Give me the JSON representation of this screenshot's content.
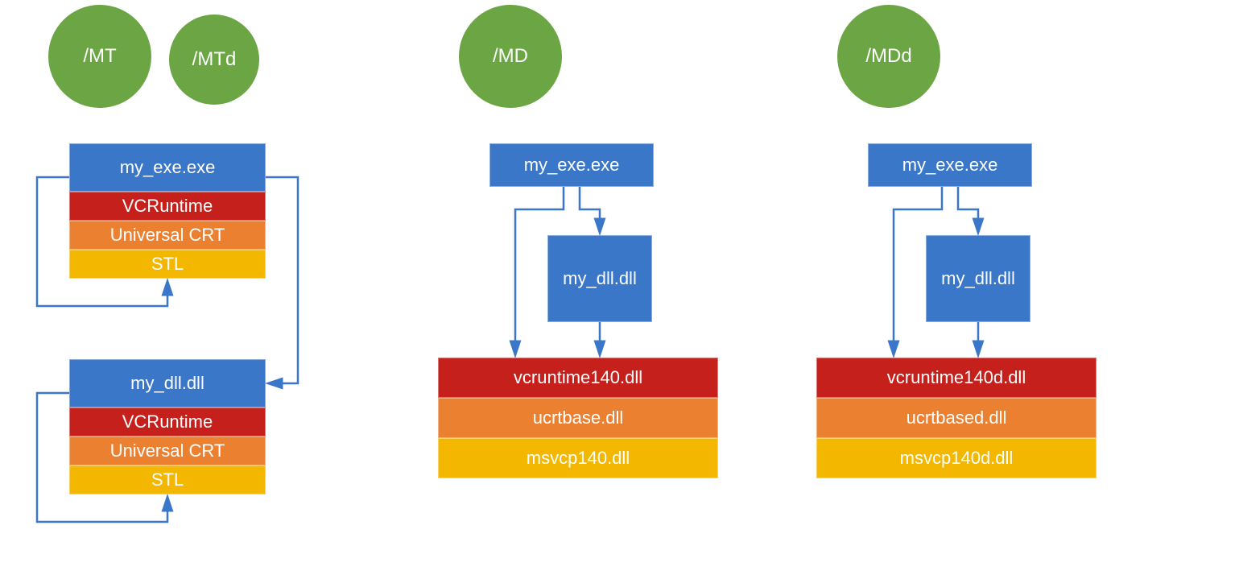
{
  "colors": {
    "green": "#6CA644",
    "blue": "#3A77C9",
    "red": "#C6201C",
    "orange": "#EB8031",
    "yellow": "#F3B700",
    "arrow": "#3A77C9"
  },
  "column1": {
    "circles": [
      "/MT",
      "/MTd"
    ],
    "stack1": {
      "exe": "my_exe.exe",
      "vcr": "VCRuntime",
      "ucrt": "Universal CRT",
      "stl": "STL"
    },
    "stack2": {
      "dll": "my_dll.dll",
      "vcr": "VCRuntime",
      "ucrt": "Universal CRT",
      "stl": "STL"
    }
  },
  "column2": {
    "circle": "/MD",
    "exe": "my_exe.exe",
    "dll": "my_dll.dll",
    "libs": {
      "vcr": "vcruntime140.dll",
      "ucrt": "ucrtbase.dll",
      "stl": "msvcp140.dll"
    }
  },
  "column3": {
    "circle": "/MDd",
    "exe": "my_exe.exe",
    "dll": "my_dll.dll",
    "libs": {
      "vcr": "vcruntime140d.dll",
      "ucrt": "ucrtbased.dll",
      "stl": "msvcp140d.dll"
    }
  }
}
